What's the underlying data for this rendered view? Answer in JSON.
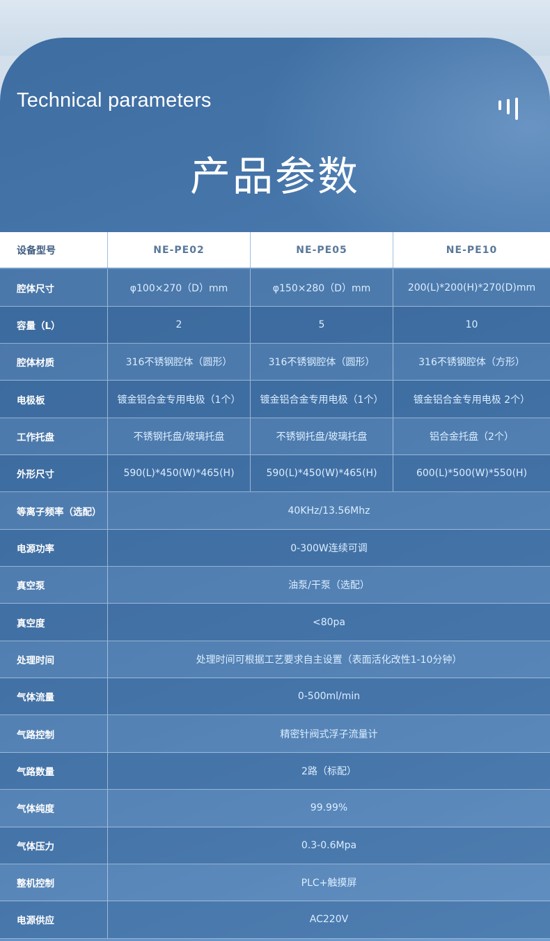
{
  "header": {
    "en_title": "Technical parameters",
    "cn_title": "产品参数"
  },
  "icons": {
    "menu": "vertical-bars-icon"
  },
  "colors": {
    "panel": "#4a7aaf",
    "cell_text": "#dbeeff",
    "header_text": "#5a7899"
  },
  "table": {
    "header": {
      "label": "设备型号",
      "cols": [
        "NE-PE02",
        "NE-PE05",
        "NE-PE10"
      ]
    },
    "rows": [
      {
        "label": "腔体尺寸",
        "cols": [
          "φ100×270（D）mm",
          "φ150×280（D）mm",
          "200(L)*200(H)*270(D)mm"
        ]
      },
      {
        "label": "容量（L）",
        "cols": [
          "2",
          "5",
          "10"
        ]
      },
      {
        "label": "腔体材质",
        "cols": [
          "316不锈钢腔体（圆形）",
          "316不锈钢腔体（圆形）",
          "316不锈钢腔体（方形）"
        ]
      },
      {
        "label": "电极板",
        "cols": [
          "镀金铝合金专用电极（1个）",
          "镀金铝合金专用电极（1个）",
          "镀金铝合金专用电极 2个）"
        ]
      },
      {
        "label": "工作托盘",
        "cols": [
          "不锈钢托盘/玻璃托盘",
          "不锈钢托盘/玻璃托盘",
          "铝合金托盘（2个）"
        ]
      },
      {
        "label": "外形尺寸",
        "cols": [
          "590(L)*450(W)*465(H)",
          "590(L)*450(W)*465(H)",
          "600(L)*500(W)*550(H)"
        ]
      }
    ],
    "span_rows": [
      {
        "label": "等离子频率（选配）",
        "value": "40KHz/13.56Mhz"
      },
      {
        "label": "电源功率",
        "value": "0-300W连续可调"
      },
      {
        "label": "真空泵",
        "value": "油泵/干泵（选配）"
      },
      {
        "label": "真空度",
        "value": "<80pa"
      },
      {
        "label": "处理时间",
        "value": "处理时间可根据工艺要求自主设置（表面活化改性1-10分钟）"
      },
      {
        "label": "气体流量",
        "value": "0-500ml/min"
      },
      {
        "label": "气路控制",
        "value": "精密针阀式浮子流量计"
      },
      {
        "label": "气路数量",
        "value": "2路（标配）"
      },
      {
        "label": "气体纯度",
        "value": "99.99%"
      },
      {
        "label": "气体压力",
        "value": "0.3-0.6Mpa"
      },
      {
        "label": "整机控制",
        "value": "PLC+触摸屏"
      },
      {
        "label": "电源供应",
        "value": "AC220V"
      }
    ]
  }
}
